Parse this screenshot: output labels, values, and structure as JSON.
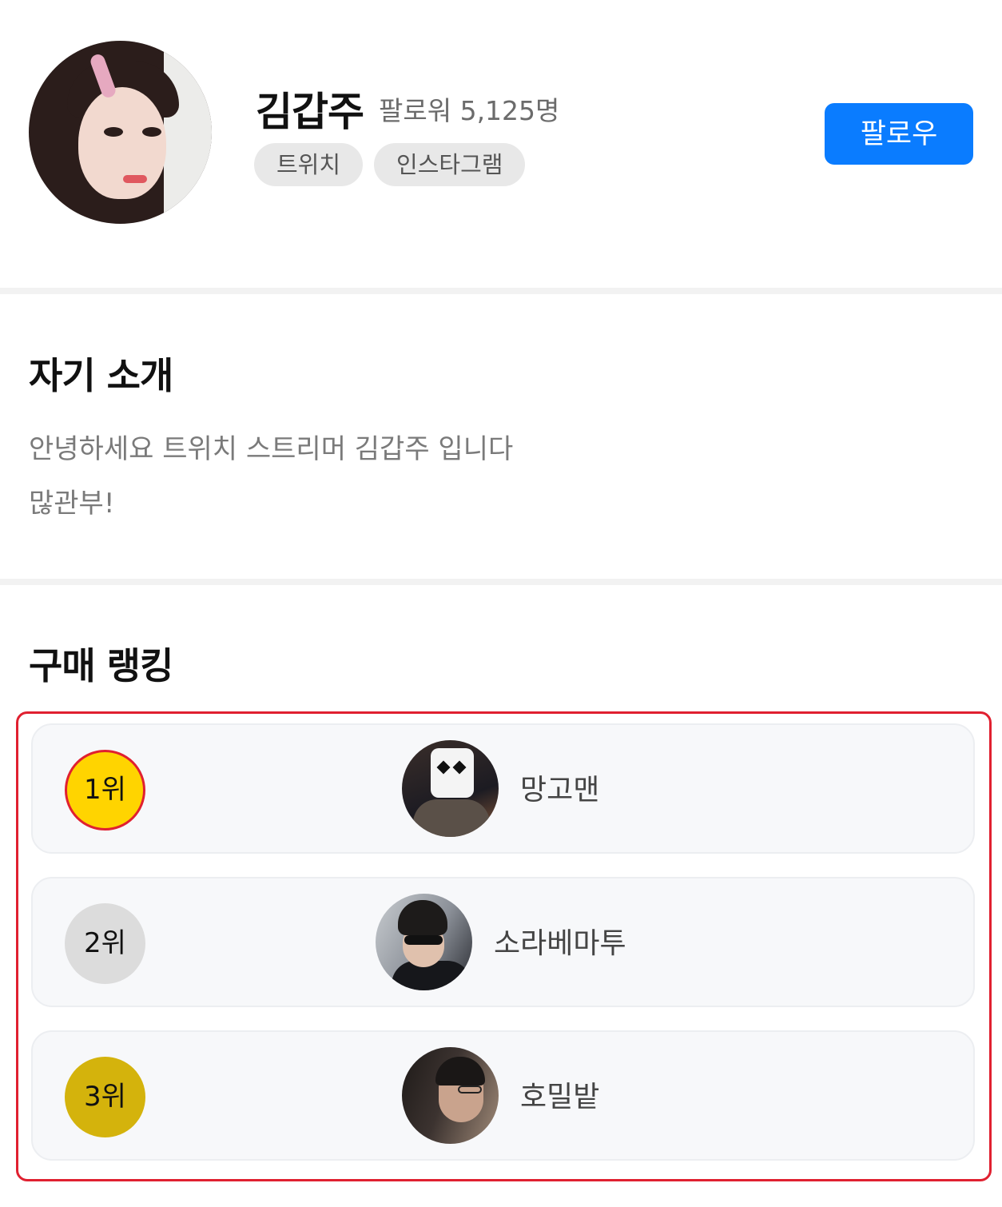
{
  "profile": {
    "name": "김갑주",
    "followers": "팔로워 5,125명",
    "tags": [
      "트위치",
      "인스타그램"
    ],
    "follow_button": "팔로우"
  },
  "intro": {
    "title": "자기 소개",
    "lines": [
      "안녕하세요 트위치 스트리머 김갑주 입니다",
      "많관부!"
    ]
  },
  "ranking": {
    "title": "구매 랭킹",
    "items": [
      {
        "rank": "1위",
        "name": "망고맨",
        "badge_color": "#ffd400"
      },
      {
        "rank": "2위",
        "name": "소라베마투",
        "badge_color": "#dcdcdc"
      },
      {
        "rank": "3위",
        "name": "호밀밭",
        "badge_color": "#d4b30c"
      }
    ]
  },
  "colors": {
    "accent": "#0a7cff",
    "highlight_border": "#e02030"
  }
}
